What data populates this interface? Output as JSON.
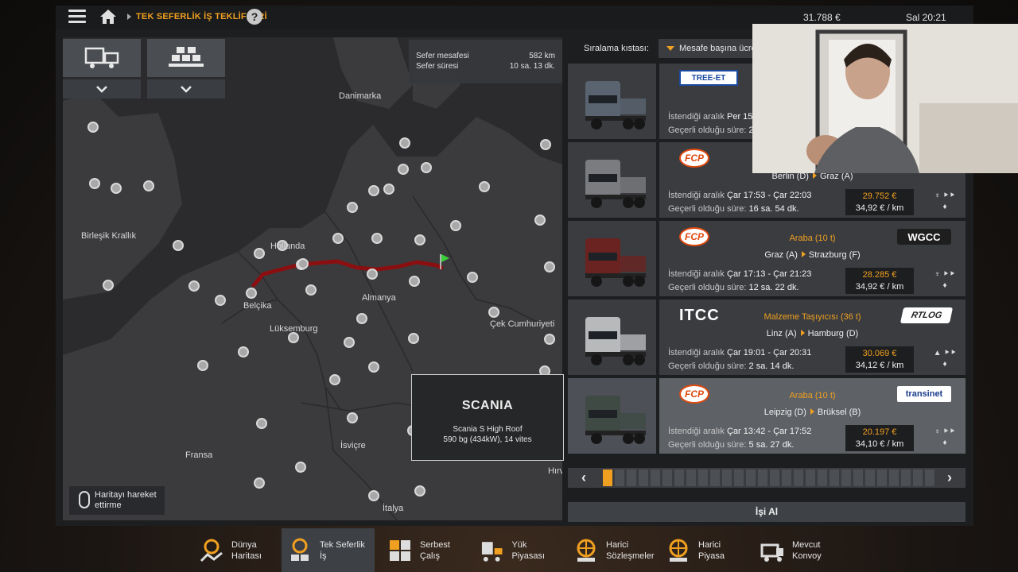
{
  "topbar": {
    "breadcrumb": "TEK SEFERLİK İŞ TEKLİFLERİ",
    "help": "?",
    "money": "31.788 €",
    "clock": "Sal 20:21"
  },
  "map": {
    "info": {
      "distance_label": "Sefer mesafesi",
      "distance_value": "582 km",
      "duration_label": "Sefer süresi",
      "duration_value": "10 sa. 13 dk."
    },
    "labels": {
      "danimarka": "Danimarka",
      "birlesik": "Birleşik Krallık",
      "hollanda": "Hollanda",
      "belcika": "Belçika",
      "almanya": "Almanya",
      "luksemburg": "Lüksemburg",
      "cek": "Çek Cumhuriyeti",
      "fransa": "Fransa",
      "isvicre": "İsviçre",
      "italya": "İtalya",
      "hirv": "Hırv"
    },
    "truck": {
      "brand": "SCANIA",
      "model": "Scania S High Roof",
      "spec": "590 bg (434kW), 14 vites"
    },
    "move_hint": "Haritayı hareket\nettirme"
  },
  "sort": {
    "label": "Sıralama kıstası:",
    "value": "Mesafe başına ücret"
  },
  "jobs": [
    {
      "company": "TREE-ET",
      "company_style": "tree",
      "cargo": "",
      "from": "",
      "to": "",
      "dest_logo": "",
      "dest_style": "",
      "time_label": "İstendiği aralık",
      "time_value": "Per 15",
      "valid_label": "Geçerli olduğu süre:",
      "valid_value": "2",
      "pay": "",
      "rate": "",
      "icons": ""
    },
    {
      "company": "FCP",
      "company_style": "fcp",
      "cargo": "",
      "from": "Berlin (D)",
      "to": "Graz (A)",
      "dest_logo": "",
      "dest_style": "",
      "time_label": "İstendiği aralık",
      "time_value": "Çar 17:53 - Çar 22:03",
      "valid_label": "Geçerli olduğu süre:",
      "valid_value": "16 sa. 54 dk.",
      "pay": "29.752 €",
      "rate": "34,92 € / km",
      "icons": "♆ ⯈⯈\n♦"
    },
    {
      "company": "FCP",
      "company_style": "fcp",
      "cargo": "Araba (10 t)",
      "from": "Graz (A)",
      "to": "Strazburg (F)",
      "dest_logo": "WGCC",
      "dest_style": "wgcc",
      "time_label": "İstendiği aralık",
      "time_value": "Çar 17:13 - Çar 21:23",
      "valid_label": "Geçerli olduğu süre:",
      "valid_value": "12 sa. 22 dk.",
      "pay": "28.285 €",
      "rate": "34,92 € / km",
      "icons": "♆ ⯈⯈\n♦"
    },
    {
      "company": "ITCC",
      "company_style": "itcc",
      "cargo": "Malzeme Taşıyıcısı (36 t)",
      "from": "Linz (A)",
      "to": "Hamburg (D)",
      "dest_logo": "RTLOG",
      "dest_style": "rtlog",
      "time_label": "İstendiği aralık",
      "time_value": "Çar 19:01 - Çar 20:31",
      "valid_label": "Geçerli olduğu süre:",
      "valid_value": "2 sa. 14 dk.",
      "pay": "30.069 €",
      "rate": "34,12 € / km",
      "icons": "▲ ⯈⯈\n♦"
    },
    {
      "company": "FCP",
      "company_style": "fcp",
      "cargo": "Araba (10 t)",
      "from": "Leipzig (D)",
      "to": "Brüksel (B)",
      "dest_logo": "transinet",
      "dest_style": "transinet",
      "time_label": "İstendiği aralık",
      "time_value": "Çar 13:42 - Çar 17:52",
      "valid_label": "Geçerli olduğu süre:",
      "valid_value": "5 sa. 27 dk.",
      "pay": "20.197 €",
      "rate": "34,10 € / km",
      "icons": "♆ ⯈⯈\n♦"
    }
  ],
  "pager": {
    "prev": "‹",
    "next": "›",
    "active_page": 1,
    "page_count": 28
  },
  "take_job": "İşi Al",
  "bottom_nav": [
    {
      "label": "Dünya\nHaritası",
      "icon": "world-map-icon"
    },
    {
      "label": "Tek Seferlik\nİş",
      "icon": "clock-cargo-icon"
    },
    {
      "label": "Serbest\nÇalış",
      "icon": "boxes-icon"
    },
    {
      "label": "Yük Piyasası",
      "icon": "forklift-icon"
    },
    {
      "label": "Harici\nSözleşmeler",
      "icon": "globe-cargo-icon"
    },
    {
      "label": "Harici\nPiyasa",
      "icon": "globe-forklift-icon"
    },
    {
      "label": "Mevcut\nKonvoy",
      "icon": "convoy-icon"
    }
  ],
  "colors": {
    "accent": "#f0a020",
    "route": "#8b0f10",
    "panel": "#1d1e20"
  }
}
